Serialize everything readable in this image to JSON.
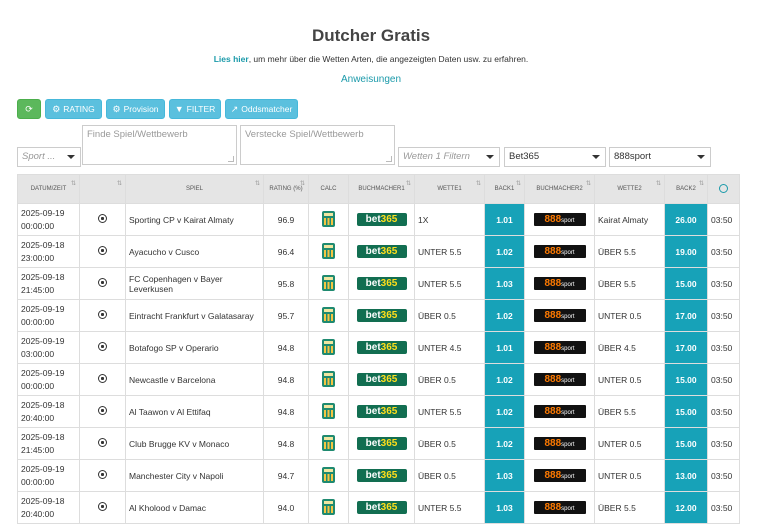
{
  "page": {
    "title": "Dutcher Gratis",
    "intro_link": "Lies hier",
    "intro_rest": ", um mehr über die Wetten Arten, die angezeigten Daten usw. zu erfahren.",
    "instructions": "Anweisungen"
  },
  "toolbar": {
    "refresh_icon": "refresh-icon",
    "rating": "RATING",
    "provision": "Provision",
    "filter": "FILTER",
    "oddsmatcher": "Oddsmatcher"
  },
  "filters": {
    "sport": "Sport ...",
    "find_placeholder": "Finde Spiel/Wettbewerb",
    "hide_placeholder": "Verstecke Spiel/Wettbewerb",
    "bet_filter": "Wetten 1 Filtern",
    "bookmaker1": "Bet365",
    "bookmaker2": "888sport"
  },
  "table": {
    "headers": [
      "DATUM/ZEIT",
      "",
      "SPIEL",
      "RATING (%)",
      "CALC",
      "BUCHMACHER1",
      "WETTE1",
      "BACK1",
      "BUCHMACHER2",
      "WETTE2",
      "BACK2",
      ""
    ],
    "rows": [
      {
        "date": "2025-09-19",
        "time": "00:00:00",
        "game": "Sporting CP v Kairat Almaty",
        "rating": "96.9",
        "bet1": "1X",
        "back1": "1.01",
        "bet2": "Kairat Almaty",
        "back2": "26.00",
        "clock": "03:50"
      },
      {
        "date": "2025-09-18",
        "time": "23:00:00",
        "game": "Ayacucho v Cusco",
        "rating": "96.4",
        "bet1": "UNTER 5.5",
        "back1": "1.02",
        "bet2": "ÜBER 5.5",
        "back2": "19.00",
        "clock": "03:50"
      },
      {
        "date": "2025-09-18",
        "time": "21:45:00",
        "game": "FC Copenhagen v Bayer Leverkusen",
        "rating": "95.8",
        "bet1": "UNTER 5.5",
        "back1": "1.03",
        "bet2": "ÜBER 5.5",
        "back2": "15.00",
        "clock": "03:50"
      },
      {
        "date": "2025-09-19",
        "time": "00:00:00",
        "game": "Eintracht Frankfurt v Galatasaray",
        "rating": "95.7",
        "bet1": "ÜBER 0.5",
        "back1": "1.02",
        "bet2": "UNTER 0.5",
        "back2": "17.00",
        "clock": "03:50"
      },
      {
        "date": "2025-09-19",
        "time": "03:00:00",
        "game": "Botafogo SP v Operario",
        "rating": "94.8",
        "bet1": "UNTER 4.5",
        "back1": "1.01",
        "bet2": "ÜBER 4.5",
        "back2": "17.00",
        "clock": "03:50"
      },
      {
        "date": "2025-09-19",
        "time": "00:00:00",
        "game": "Newcastle v Barcelona",
        "rating": "94.8",
        "bet1": "ÜBER 0.5",
        "back1": "1.02",
        "bet2": "UNTER 0.5",
        "back2": "15.00",
        "clock": "03:50"
      },
      {
        "date": "2025-09-18",
        "time": "20:40:00",
        "game": "Al Taawon v Al Ettifaq",
        "rating": "94.8",
        "bet1": "UNTER 5.5",
        "back1": "1.02",
        "bet2": "ÜBER 5.5",
        "back2": "15.00",
        "clock": "03:50"
      },
      {
        "date": "2025-09-18",
        "time": "21:45:00",
        "game": "Club Brugge KV v Monaco",
        "rating": "94.8",
        "bet1": "ÜBER 0.5",
        "back1": "1.02",
        "bet2": "UNTER 0.5",
        "back2": "15.00",
        "clock": "03:50"
      },
      {
        "date": "2025-09-19",
        "time": "00:00:00",
        "game": "Manchester City v Napoli",
        "rating": "94.7",
        "bet1": "ÜBER 0.5",
        "back1": "1.03",
        "bet2": "UNTER 0.5",
        "back2": "13.00",
        "clock": "03:50"
      },
      {
        "date": "2025-09-18",
        "time": "20:40:00",
        "game": "Al Kholood v Damac",
        "rating": "94.0",
        "bet1": "UNTER 5.5",
        "back1": "1.03",
        "bet2": "ÜBER 5.5",
        "back2": "12.00",
        "clock": "03:50"
      }
    ]
  },
  "colors": {
    "accent": "#1b9aaa",
    "back_cell": "#17a2b8",
    "refresh_button": "#5cb85c",
    "info_button": "#5bc0de"
  }
}
